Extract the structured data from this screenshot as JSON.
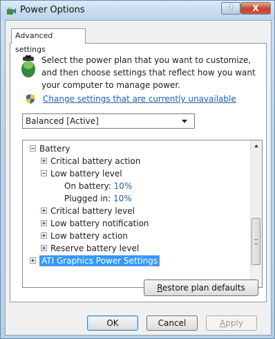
{
  "window": {
    "title": "Power Options",
    "help_label": "?",
    "close_label": "X"
  },
  "tab": {
    "label": "Advanced settings"
  },
  "description": "Select the power plan that you want to customize, and then choose settings that reflect how you want your computer to manage power.",
  "change_link": "Change settings that are currently unavailable",
  "plan_dropdown": {
    "selected": "Balanced [Active]"
  },
  "tree": {
    "battery": "Battery",
    "critical_battery_action": "Critical battery action",
    "low_battery_level": "Low battery level",
    "on_battery_label": "On battery:",
    "on_battery_value": "10%",
    "plugged_in_label": "Plugged in:",
    "plugged_in_value": "10%",
    "critical_battery_level": "Critical battery level",
    "low_battery_notification": "Low battery notification",
    "low_battery_action": "Low battery action",
    "reserve_battery_level": "Reserve battery level",
    "ati_graphics": "ATI Graphics Power Settings"
  },
  "buttons": {
    "restore_first": "R",
    "restore_rest": "estore plan defaults",
    "ok": "OK",
    "cancel": "Cancel",
    "apply_first": "A",
    "apply_rest": "pply"
  },
  "colors": {
    "link": "#1a5fb4",
    "selection": "#3399ff",
    "close_button": "#c8432b"
  }
}
